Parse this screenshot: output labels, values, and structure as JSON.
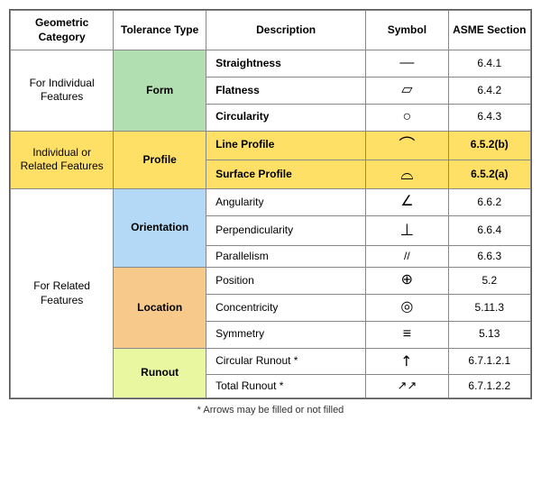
{
  "headers": {
    "geo_category": "Geometric Category",
    "tol_type": "Tolerance Type",
    "description": "Description",
    "symbol": "Symbol",
    "asme_section": "ASME Section"
  },
  "sections": [
    {
      "geo_label": "For Individual Features",
      "geo_rowspan": 3,
      "tol_label": "Form",
      "tol_rowspan": 3,
      "tol_bg": "bg-green",
      "rows": [
        {
          "desc": "Straightness",
          "symbol": "—",
          "asme": "6.4.1",
          "desc_bold": true,
          "asme_bg": ""
        },
        {
          "desc": "Flatness",
          "symbol": "▱",
          "asme": "6.4.2",
          "desc_bold": true,
          "asme_bg": ""
        },
        {
          "desc": "Circularity",
          "symbol": "○",
          "asme": "6.4.3",
          "desc_bold": true,
          "asme_bg": ""
        }
      ]
    },
    {
      "geo_label": "Individual or Related Features",
      "geo_rowspan": 2,
      "tol_label": "Profile",
      "tol_rowspan": 2,
      "tol_bg": "bg-yellow",
      "rows": [
        {
          "desc": "Line Profile",
          "symbol": "⌒",
          "asme": "6.5.2(b)",
          "desc_bold": true,
          "asme_bg": "asme-highlight"
        },
        {
          "desc": "Surface Profile",
          "symbol": "⌓",
          "asme": "6.5.2(a)",
          "desc_bold": true,
          "asme_bg": "asme-highlight"
        }
      ]
    },
    {
      "geo_label": "For Related Features",
      "geo_rowspan": 8,
      "sub_sections": [
        {
          "tol_label": "Orientation",
          "tol_rowspan": 3,
          "tol_bg": "bg-blue",
          "rows": [
            {
              "desc": "Angularity",
              "symbol": "∠",
              "asme": "6.6.2",
              "desc_bold": false,
              "asme_bg": ""
            },
            {
              "desc": "Perpendicularity",
              "symbol": "⊥",
              "asme": "6.6.4",
              "desc_bold": false,
              "asme_bg": ""
            },
            {
              "desc": "Parallelism",
              "symbol": "//",
              "asme": "6.6.3",
              "desc_bold": false,
              "asme_bg": ""
            }
          ]
        },
        {
          "tol_label": "Location",
          "tol_rowspan": 3,
          "tol_bg": "bg-orange",
          "rows": [
            {
              "desc": "Position",
              "symbol": "⊕",
              "asme": "5.2",
              "desc_bold": false,
              "asme_bg": ""
            },
            {
              "desc": "Concentricity",
              "symbol": "◎",
              "asme": "5.11.3",
              "desc_bold": false,
              "asme_bg": ""
            },
            {
              "desc": "Symmetry",
              "symbol": "≡",
              "asme": "5.13",
              "desc_bold": false,
              "asme_bg": ""
            }
          ]
        },
        {
          "tol_label": "Runout",
          "tol_rowspan": 2,
          "tol_bg": "bg-lime",
          "rows": [
            {
              "desc": "Circular Runout *",
              "symbol": "↗",
              "asme": "6.7.1.2.1",
              "desc_bold": false,
              "asme_bg": ""
            },
            {
              "desc": "Total Runout *",
              "symbol": "↗↗",
              "asme": "6.7.1.2.2",
              "desc_bold": false,
              "asme_bg": ""
            }
          ]
        }
      ]
    }
  ],
  "footer": "* Arrows may be filled or not filled"
}
